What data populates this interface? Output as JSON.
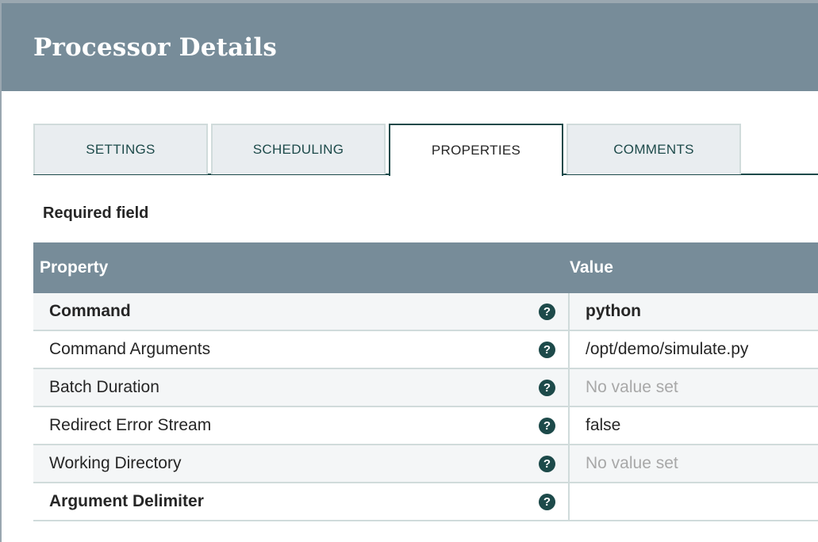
{
  "dialog": {
    "title": "Processor Details"
  },
  "tabs": [
    {
      "label": "SETTINGS"
    },
    {
      "label": "SCHEDULING"
    },
    {
      "label": "PROPERTIES",
      "active": true
    },
    {
      "label": "COMMENTS"
    }
  ],
  "required_label": "Required field",
  "table": {
    "headers": {
      "property": "Property",
      "value": "Value"
    },
    "rows": [
      {
        "property": "Command",
        "value": "python",
        "required": true,
        "placeholder": false
      },
      {
        "property": "Command Arguments",
        "value": "/opt/demo/simulate.py",
        "required": false,
        "placeholder": false
      },
      {
        "property": "Batch Duration",
        "value": "No value set",
        "required": false,
        "placeholder": true
      },
      {
        "property": "Redirect Error Stream",
        "value": "false",
        "required": false,
        "placeholder": false
      },
      {
        "property": "Working Directory",
        "value": "No value set",
        "required": false,
        "placeholder": true
      },
      {
        "property": "Argument Delimiter",
        "value": "",
        "required": true,
        "placeholder": false
      }
    ]
  },
  "icons": {
    "help": "question-circle-icon",
    "help_glyph": "?"
  },
  "colors": {
    "header": "#778c99",
    "accent": "#1d4a4a"
  }
}
